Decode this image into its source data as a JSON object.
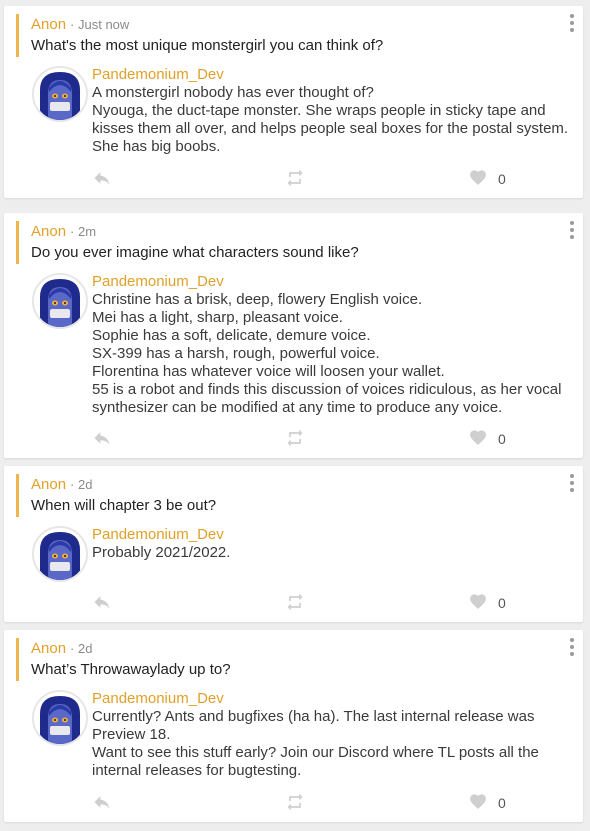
{
  "colors": {
    "accent": "#f0b64b",
    "author": "#e0a12a",
    "icon": "#cfcfcf"
  },
  "icons": {
    "reply": "reply-icon",
    "repost": "repost-icon",
    "like": "heart-icon",
    "more": "more-vertical-icon"
  },
  "posts": [
    {
      "question": {
        "author": "Anon",
        "time": "Just now",
        "text": "What's the most unique monstergirl you can think of?"
      },
      "answer": {
        "author": "Pandemonium_Dev",
        "lines": [
          "A monstergirl nobody has ever thought of?",
          "Nyouga, the duct-tape monster. She wraps people in sticky tape and",
          "kisses them all over, and helps people seal boxes for the postal system.",
          "She has big boobs."
        ]
      },
      "likes": "0"
    },
    {
      "question": {
        "author": "Anon",
        "time": "2m",
        "text": "Do you ever imagine what characters sound like?"
      },
      "answer": {
        "author": "Pandemonium_Dev",
        "lines": [
          "Christine has a brisk, deep, flowery English voice.",
          "Mei has a light, sharp, pleasant voice.",
          "Sophie has a soft, delicate, demure voice.",
          "SX-399 has a harsh, rough, powerful voice.",
          "Florentina has whatever voice will loosen your wallet.",
          "55 is a robot and finds this discussion of voices ridiculous, as her vocal",
          "synthesizer can be modified at any time to produce any voice."
        ]
      },
      "likes": "0"
    },
    {
      "question": {
        "author": "Anon",
        "time": "2d",
        "text": "When will chapter 3 be out?"
      },
      "answer": {
        "author": "Pandemonium_Dev",
        "lines": [
          "Probably 2021/2022."
        ]
      },
      "likes": "0"
    },
    {
      "question": {
        "author": "Anon",
        "time": "2d",
        "text": "What’s Throwawaylady up to?"
      },
      "answer": {
        "author": "Pandemonium_Dev",
        "lines": [
          "Currently? Ants and bugfixes (ha ha). The last internal release was",
          "Preview 18.",
          "Want to see this stuff early? Join our Discord where TL posts all the",
          "internal releases for bugtesting."
        ]
      },
      "likes": "0"
    }
  ]
}
